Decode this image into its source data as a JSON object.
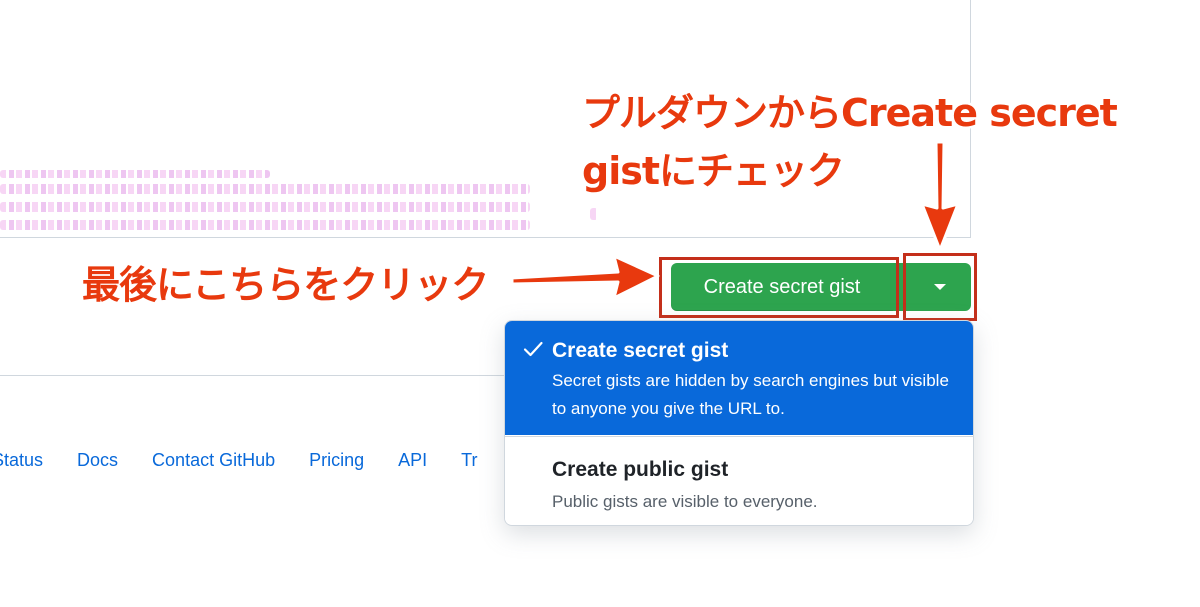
{
  "create_button": {
    "label": "Create secret gist",
    "caret_icon": "triangle-down-icon",
    "color": "#2da44e"
  },
  "dropdown": {
    "items": [
      {
        "title": "Create secret gist",
        "description": "Secret gists are hidden by search engines but visible to anyone you give the URL to.",
        "selected": true,
        "icon": "check-icon"
      },
      {
        "title": "Create public gist",
        "description": "Public gists are visible to everyone.",
        "selected": false
      }
    ],
    "selected_color": "#0969da"
  },
  "footer": {
    "links": [
      "Status",
      "Docs",
      "Contact GitHub",
      "Pricing",
      "API",
      "Tr"
    ]
  },
  "annotations": {
    "dropdown_hint_line1": "プルダウンからCreate secret",
    "dropdown_hint_line2": "gistにチェック",
    "final_click_hint": "最後にこちらをクリック",
    "color": "#e8390e"
  }
}
